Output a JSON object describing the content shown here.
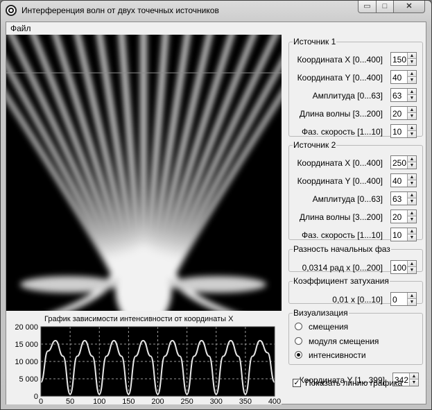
{
  "window": {
    "title": "Интерференция волн от двух точечных источников",
    "min_glyph": "▭",
    "max_glyph": "□",
    "close_glyph": "✕"
  },
  "menu": {
    "file": "Файл"
  },
  "source1": {
    "legend": "Источник 1",
    "fields": [
      {
        "label": "Координата X [0...400]",
        "value": "150"
      },
      {
        "label": "Координата Y [0...400]",
        "value": "40"
      },
      {
        "label": "Амплитуда [0...63]",
        "value": "63"
      },
      {
        "label": "Длина волны [3...200]",
        "value": "20"
      },
      {
        "label": "Фаз. скорость [1...10]",
        "value": "10"
      }
    ]
  },
  "source2": {
    "legend": "Источник 2",
    "fields": [
      {
        "label": "Координата X [0...400]",
        "value": "250"
      },
      {
        "label": "Координата Y [0...400]",
        "value": "40"
      },
      {
        "label": "Амплитуда [0...63]",
        "value": "63"
      },
      {
        "label": "Длина волны [3...200]",
        "value": "20"
      },
      {
        "label": "Фаз. скорость [1...10]",
        "value": "10"
      }
    ]
  },
  "phase": {
    "legend": "Разность начальных фаз",
    "label": "0,0314 рад  x  [0...200]",
    "value": "100"
  },
  "attenuation": {
    "legend": "Коэффициент затухания",
    "label": "0,01  x  [0...10]",
    "value": "0"
  },
  "visualization": {
    "legend": "Визуализация",
    "options": [
      {
        "label": "смещения",
        "selected": false
      },
      {
        "label": "модуля смещения",
        "selected": false
      },
      {
        "label": "интенсивности",
        "selected": true
      }
    ]
  },
  "coord_y": {
    "label": "Координата Y [1...399]",
    "value": "342"
  },
  "show_line": {
    "label": "Показать линию графика",
    "checked": true,
    "mark": "✓"
  },
  "spin_up": "▲",
  "spin_down": "▼",
  "chart_data": {
    "type": "line",
    "title": "График зависимости интенсивности от координаты X",
    "xlabel": "",
    "ylabel": "",
    "xlim": [
      0,
      400
    ],
    "ylim": [
      0,
      20000
    ],
    "x_ticks": [
      "0",
      "50",
      "100",
      "150",
      "200",
      "250",
      "300",
      "350",
      "400"
    ],
    "y_ticks": [
      "0",
      "5 000",
      "10 000",
      "15 000",
      "20 000"
    ],
    "grid": true,
    "series": [
      {
        "x": [
          0,
          12,
          25,
          38,
          50,
          62,
          75,
          88,
          100,
          112,
          125,
          138,
          150,
          162,
          175,
          188,
          200,
          212,
          225,
          238,
          250,
          262,
          275,
          288,
          300,
          312,
          325,
          338,
          350,
          362,
          375,
          388,
          400
        ],
        "values": [
          4000,
          13000,
          16000,
          11500,
          500,
          11500,
          16000,
          11500,
          500,
          11500,
          16000,
          11500,
          500,
          11500,
          16000,
          11500,
          500,
          11500,
          16000,
          11500,
          500,
          11500,
          16000,
          11500,
          500,
          11500,
          16000,
          11500,
          500,
          11500,
          16000,
          12500,
          4000
        ]
      }
    ]
  },
  "colors": {
    "plot_bg": "#000000",
    "plot_line": "#e6e6e6",
    "grid": "#9a9a9a"
  }
}
